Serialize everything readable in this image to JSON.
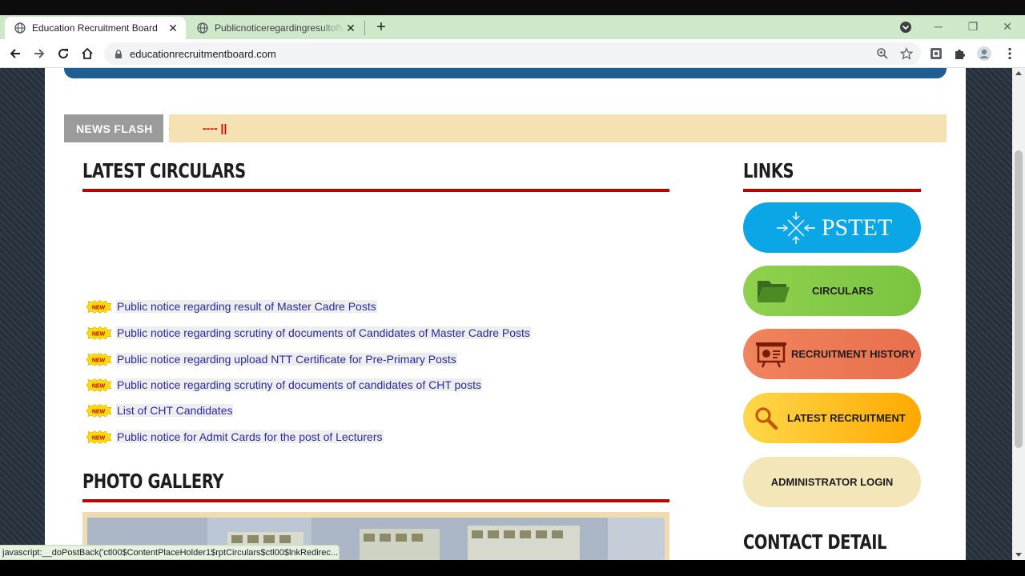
{
  "browser": {
    "tabs": [
      {
        "title": "Education Recruitment Board",
        "active": true
      },
      {
        "title": "PublicnoticeregardingresultofMa",
        "active": false
      }
    ],
    "new_tab_label": "+",
    "close_glyph": "✕",
    "url": "educationrecruitmentboard.com",
    "window_controls": {
      "minimize": "─",
      "restore": "❐",
      "close": "✕"
    },
    "status_text": "javascript:__doPostBack('ctl00$ContentPlaceHolder1$rptCirculars$ctl00$lnkRedirec..."
  },
  "page": {
    "news_flash": {
      "label": "NEWS FLASH",
      "ticker": "---- ||"
    },
    "latest_circulars": {
      "title": "LATEST CIRCULARS",
      "badge_text": "NEW",
      "items": [
        "Public notice regarding result of Master Cadre Posts",
        "Public notice regarding scrutiny of documents of Candidates of Master Cadre Posts",
        "Public notice regarding upload NTT Certificate for Pre-Primary Posts",
        "Public notice regarding scrutiny of documents of candidates of CHT posts",
        "List of CHT Candidates",
        "Public notice for Admit Cards for the post of Lecturers"
      ]
    },
    "photo_gallery": {
      "title": "PHOTO GALLERY"
    },
    "links": {
      "title": "LINKS",
      "buttons": {
        "pstet": "PSTET",
        "circulars": "CIRCULARS",
        "recruitment_history": "RECRUITMENT HISTORY",
        "latest_recruitment": "LATEST RECRUITMENT",
        "admin_login": "ADMINISTRATOR LOGIN"
      }
    },
    "contact": {
      "title": "CONTACT DETAIL"
    }
  },
  "colors": {
    "tab_bar": "#cfe8c9",
    "accent_red": "#c00000",
    "link_blue": "#2a2aa7",
    "news_bg": "#f5e1b4",
    "pstet_blue": "#0aa6e6",
    "circulars_green": "#8fd14f",
    "history_orange": "#f0845c",
    "latest_yellow": "#ffb71a",
    "admin_cream": "#f3e6b8"
  },
  "icons": [
    "globe-icon",
    "back-arrow-icon",
    "forward-arrow-icon",
    "reload-icon",
    "home-icon",
    "lock-icon",
    "zoom-icon",
    "star-icon",
    "extension-icon",
    "puzzle-icon",
    "profile-avatar",
    "menu-dots-icon",
    "folder-icon",
    "presentation-icon",
    "magnifier-icon",
    "arrows-icon",
    "new-badge-icon"
  ]
}
